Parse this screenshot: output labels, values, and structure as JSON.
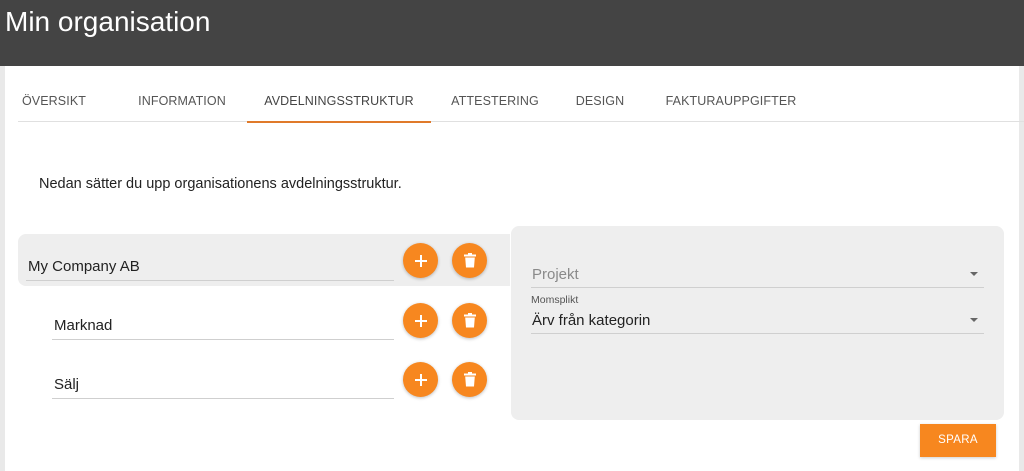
{
  "header": {
    "title": "Min organisation"
  },
  "tabs": [
    {
      "label": "ÖVERSIKT"
    },
    {
      "label": "INFORMATION"
    },
    {
      "label": "AVDELNINGSSTRUKTUR",
      "active": true
    },
    {
      "label": "ATTESTERING"
    },
    {
      "label": "DESIGN"
    },
    {
      "label": "FAKTURAUPPGIFTER"
    }
  ],
  "main": {
    "intro": "Nedan sätter du upp organisationens avdelningsstruktur.",
    "departments": [
      {
        "name": "My Company AB",
        "level": 0,
        "selected": true
      },
      {
        "name": "Marknad",
        "level": 1
      },
      {
        "name": "Sälj",
        "level": 1
      }
    ],
    "add_icon": "plus-icon",
    "delete_icon": "trash-icon"
  },
  "side_panel": {
    "project_select": {
      "placeholder": "Projekt",
      "value": ""
    },
    "vat_select": {
      "label": "Momsplikt",
      "value": "Ärv från kategorin"
    }
  },
  "actions": {
    "save_label": "SPARA"
  },
  "colors": {
    "accent": "#f7871f",
    "tab_indicator": "#e07a2a",
    "header_bg": "#444444",
    "panel_bg": "#eeeeee"
  }
}
